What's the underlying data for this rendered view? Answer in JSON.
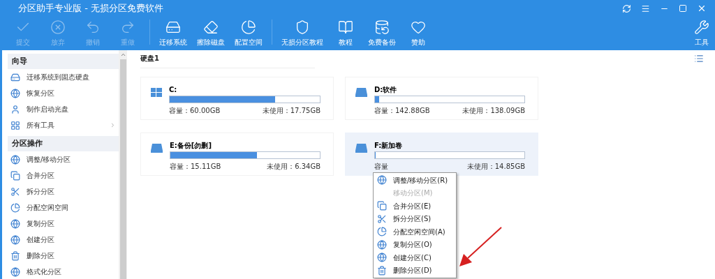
{
  "window": {
    "title": "分区助手专业版 - 无损分区免费软件"
  },
  "toolbar": [
    {
      "label": "提交",
      "disabled": true
    },
    {
      "label": "放弃",
      "disabled": true
    },
    {
      "label": "撤销",
      "disabled": true
    },
    {
      "label": "重做",
      "disabled": true
    },
    {
      "label": "迁移系统",
      "disabled": false
    },
    {
      "label": "擦除磁盘",
      "disabled": false
    },
    {
      "label": "配置空间",
      "disabled": false
    },
    {
      "label": "无损分区教程",
      "disabled": false
    },
    {
      "label": "教程",
      "disabled": false
    },
    {
      "label": "免费备份",
      "disabled": false
    },
    {
      "label": "赞助",
      "disabled": false
    }
  ],
  "tools_button": {
    "label": "工具"
  },
  "sidebar": [
    {
      "title": "向导",
      "items": [
        {
          "label": "迁移系统到固态硬盘",
          "submenu": false
        },
        {
          "label": "恢复分区",
          "submenu": false
        },
        {
          "label": "制作启动光盘",
          "submenu": false
        },
        {
          "label": "所有工具",
          "submenu": true
        }
      ]
    },
    {
      "title": "分区操作",
      "items": [
        {
          "label": "调整/移动分区",
          "submenu": false
        },
        {
          "label": "合并分区",
          "submenu": false
        },
        {
          "label": "拆分分区",
          "submenu": false
        },
        {
          "label": "分配空闲空间",
          "submenu": false
        },
        {
          "label": "复制分区",
          "submenu": false
        },
        {
          "label": "创建分区",
          "submenu": false
        },
        {
          "label": "删除分区",
          "submenu": false
        },
        {
          "label": "格式化分区",
          "submenu": false
        }
      ]
    }
  ],
  "disk": {
    "title": "硬盘1",
    "partitions": [
      {
        "name": "C:",
        "kind": "system",
        "level": 0.7,
        "capacity": "容量：60.00GB",
        "free": "未使用：17.75GB",
        "selected": false
      },
      {
        "name": "D:软件",
        "kind": "data",
        "level": 0.03,
        "capacity": "容量：142.88GB",
        "free": "未使用：138.09GB",
        "selected": false
      },
      {
        "name": "E:备份[勿删]",
        "kind": "data",
        "level": 0.58,
        "capacity": "容量：15.11GB",
        "free": "未使用：6.34GB",
        "selected": false
      },
      {
        "name": "F:新加卷",
        "kind": "data",
        "level": 0,
        "capacity": "容量",
        "free": "未使用：14.85GB",
        "selected": true
      }
    ]
  },
  "context_menu": [
    {
      "label": "调整/移动分区(R)",
      "disabled": false
    },
    {
      "label": "移动分区(M)",
      "disabled": true
    },
    {
      "label": "合并分区(E)",
      "disabled": false
    },
    {
      "label": "拆分分区(S)",
      "disabled": false
    },
    {
      "label": "分配空闲空间(A)",
      "disabled": false
    },
    {
      "label": "复制分区(O)",
      "disabled": false
    },
    {
      "label": "创建分区(C)",
      "disabled": false
    },
    {
      "label": "删除分区(D)",
      "disabled": false
    }
  ]
}
